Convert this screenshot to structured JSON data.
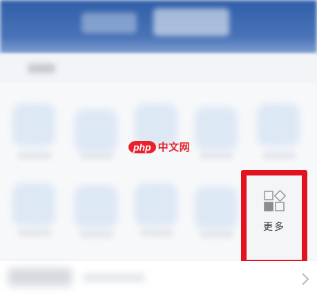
{
  "more_button": {
    "label": "更多",
    "icon": "apps-grid-icon",
    "highlight_color": "#e3121f"
  },
  "watermark": {
    "php": "php",
    "site": "中文网",
    "color": "#e8212d"
  },
  "bottom_row": {
    "icon": "chevron-right-icon"
  }
}
